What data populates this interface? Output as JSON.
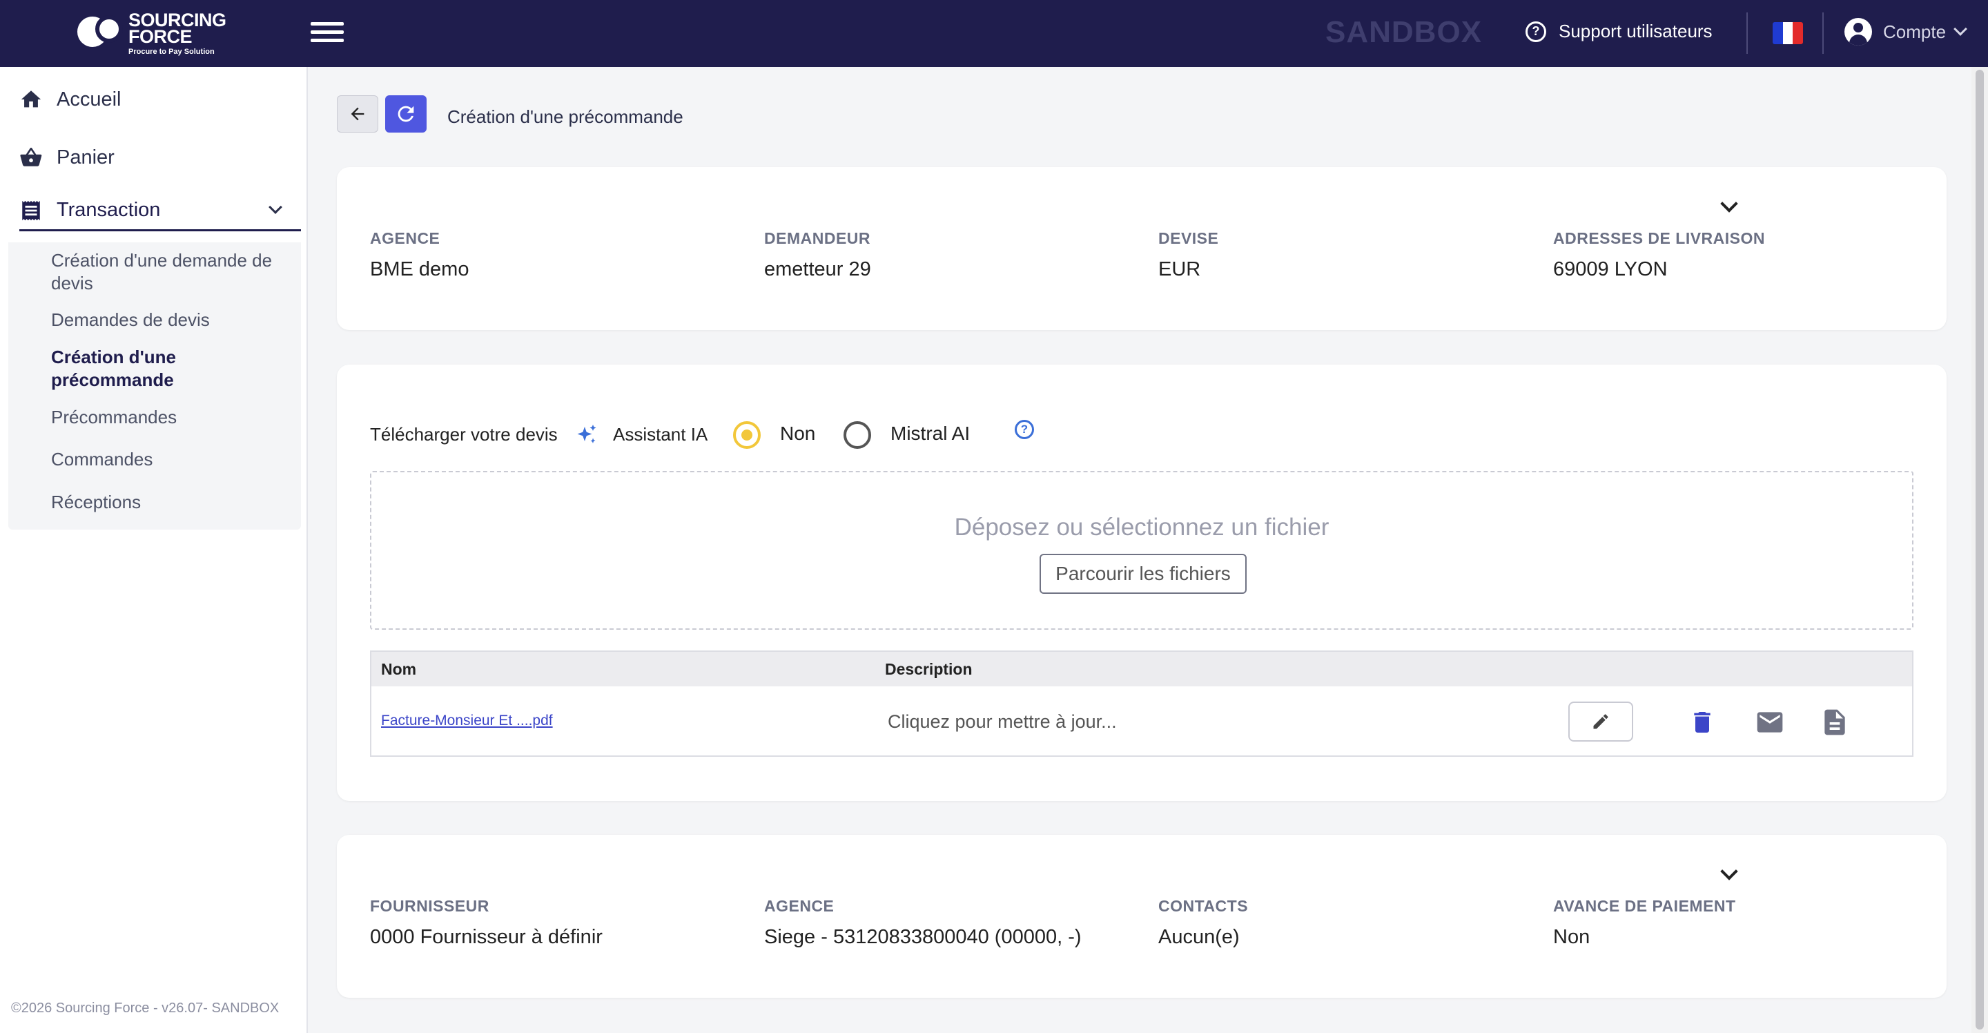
{
  "topbar": {
    "logo_line1": "SOURCING",
    "logo_line2": "FORCE",
    "logo_tagline": "Procure to Pay Solution",
    "environment": "SANDBOX",
    "support_label": "Support utilisateurs",
    "account_label": "Compte"
  },
  "sidebar": {
    "items": [
      {
        "label": "Accueil",
        "icon": "home-icon"
      },
      {
        "label": "Panier",
        "icon": "basket-icon"
      },
      {
        "label": "Transaction",
        "icon": "receipt-icon"
      }
    ],
    "submenu": [
      {
        "label": "Création d'une demande de devis"
      },
      {
        "label": "Demandes de devis"
      },
      {
        "label": "Création d'une précommande",
        "active": true
      },
      {
        "label": "Précommandes"
      },
      {
        "label": "Commandes"
      },
      {
        "label": "Réceptions"
      }
    ],
    "footer": "©2026 Sourcing Force - v26.07- SANDBOX"
  },
  "page": {
    "title": "Création d'une précommande"
  },
  "header_card": {
    "fields": [
      {
        "label": "AGENCE",
        "value": "BME demo"
      },
      {
        "label": "DEMANDEUR",
        "value": "emetteur 29"
      },
      {
        "label": "DEVISE",
        "value": "EUR"
      },
      {
        "label": "ADRESSES DE LIVRAISON",
        "value": "69009 LYON"
      }
    ]
  },
  "upload_card": {
    "upload_label": "Télécharger votre devis",
    "assistant_label": "Assistant IA",
    "radio_options": [
      {
        "label": "Non",
        "selected": true
      },
      {
        "label": "Mistral AI",
        "selected": false
      }
    ],
    "drop_text": "Déposez ou sélectionnez un fichier",
    "browse_label": "Parcourir les fichiers",
    "table": {
      "columns": [
        "Nom",
        "Description"
      ],
      "rows": [
        {
          "name": "Facture-Monsieur Et ....pdf",
          "description": "Cliquez pour mettre à jour..."
        }
      ]
    }
  },
  "supplier_card": {
    "fields": [
      {
        "label": "FOURNISSEUR",
        "value": "0000 Fournisseur à définir"
      },
      {
        "label": "AGENCE",
        "value": "Siege - 53120833800040 (00000, -)"
      },
      {
        "label": "CONTACTS",
        "value": "Aucun(e)"
      },
      {
        "label": "AVANCE DE PAIEMENT",
        "value": "Non"
      }
    ]
  },
  "colors": {
    "topbar": "#1f1d4d",
    "accent": "#4f57e0",
    "radio_selected": "#f2c73a",
    "link": "#3b45c8",
    "flag_blue": "#1f3bd1",
    "flag_red": "#e32b2b"
  }
}
